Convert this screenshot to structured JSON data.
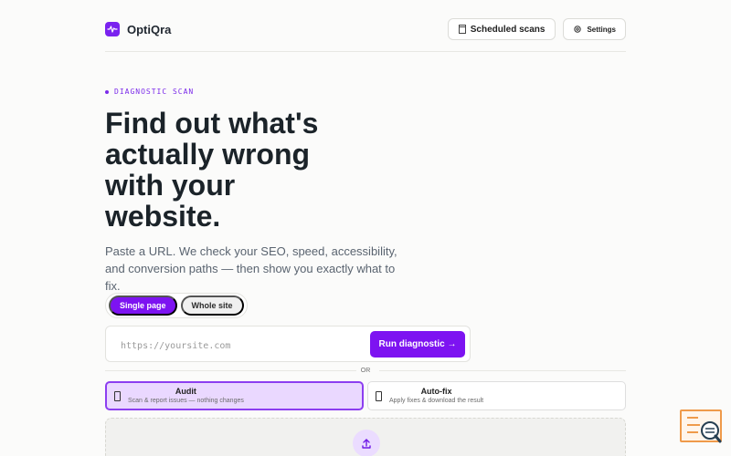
{
  "brand": {
    "name": "OptiQra",
    "icon": "pulse-icon"
  },
  "header": {
    "scheduled_label": "Scheduled scans",
    "scheduled_icon": "calendar-icon",
    "settings_label": "Settings",
    "settings_icon": "gear-icon"
  },
  "hero": {
    "kicker": "DIAGNOSTIC SCAN",
    "title": "Find out what's actually wrong with your website.",
    "subtitle": "Paste a URL. We check your SEO, speed, accessibility, and conversion paths — then show you exactly what to fix."
  },
  "scan_mode": {
    "selected": "Single page",
    "options": [
      "Single page",
      "Whole site"
    ]
  },
  "url_field": {
    "placeholder": "https://yoursite.com",
    "value": "",
    "button_label": "Run diagnostic →"
  },
  "divider": {
    "label": "OR"
  },
  "actions": [
    {
      "title": "Audit",
      "description": "Scan & report issues — nothing changes",
      "icon": "file-icon",
      "selected": true
    },
    {
      "title": "Auto-fix",
      "description": "Apply fixes & download the result",
      "icon": "file-icon",
      "selected": false
    }
  ],
  "upload": {
    "icon": "upload-icon"
  },
  "colors": {
    "accent": "#7d13f1",
    "accent_light": "#ead8ff",
    "background": "#fbfbfa",
    "text": "#1d2630"
  }
}
